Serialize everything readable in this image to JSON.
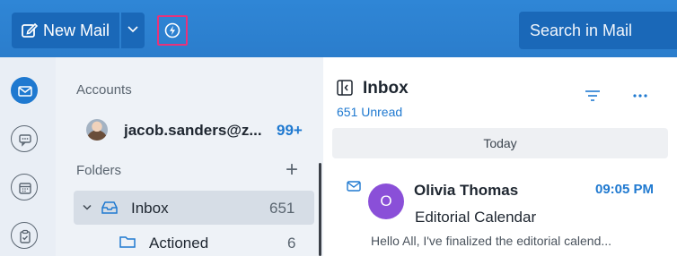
{
  "toolbar": {
    "new_mail_label": "New Mail",
    "search_placeholder": "Search in Mail"
  },
  "accounts": {
    "heading": "Accounts",
    "email": "jacob.sanders@z...",
    "count": "99+"
  },
  "folders": {
    "heading": "Folders",
    "items": [
      {
        "label": "Inbox",
        "count": "651"
      },
      {
        "label": "Actioned",
        "count": "6"
      }
    ]
  },
  "inbox": {
    "title": "Inbox",
    "unread": "651 Unread",
    "group": "Today"
  },
  "messages": [
    {
      "avatar_initial": "O",
      "sender": "Olivia Thomas",
      "time": "09:05 PM",
      "subject": "Editorial Calendar",
      "preview": "Hello All, I've finalized the editorial calend..."
    }
  ],
  "colors": {
    "accent": "#1f79d0",
    "topbar": "#2b7dcc",
    "avatar": "#8a4fd8",
    "highlight": "#e8327a"
  }
}
